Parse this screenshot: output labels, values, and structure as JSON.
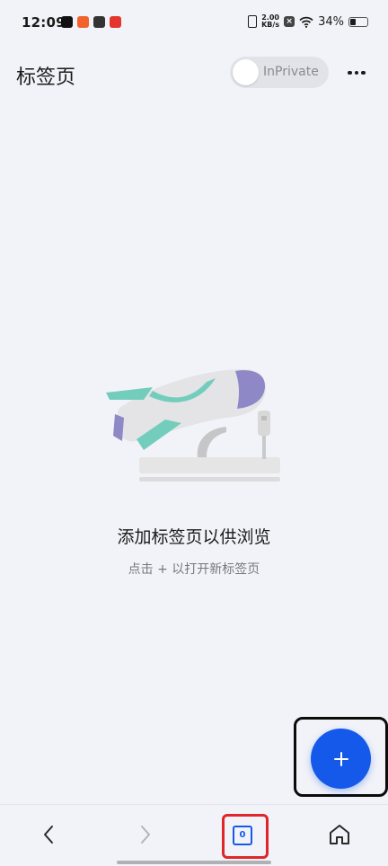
{
  "status_bar": {
    "time": "12:09",
    "network_speed_value": "2.00",
    "network_speed_unit": "KB/s",
    "battery_text": "34%",
    "battery_level": 0.34,
    "app_icons": [
      "tiktok-icon",
      "app-badge-icon",
      "link-app-icon",
      "shopping-app-icon"
    ],
    "app_icon_colors": [
      "#111111",
      "#f2622d",
      "#333333",
      "#e5352f"
    ]
  },
  "header": {
    "title": "标签页",
    "inprivate_label": "InPrivate",
    "more_icon": "more-horizontal-icon"
  },
  "empty_state": {
    "illustration": "airplane-ride-illustration",
    "title": "添加标签页以供浏览",
    "subtitle": "点击 + 以打开新标签页"
  },
  "fab": {
    "icon": "plus-icon",
    "color": "#1559ea"
  },
  "bottom_bar": {
    "back_icon": "chevron-left-icon",
    "forward_icon": "chevron-right-icon",
    "tab_count": "0",
    "home_icon": "home-icon"
  },
  "colors": {
    "background": "#f2f3f8",
    "accent": "#1559ea",
    "highlight_black": "#0b0b0b",
    "highlight_red": "#e0262b"
  }
}
